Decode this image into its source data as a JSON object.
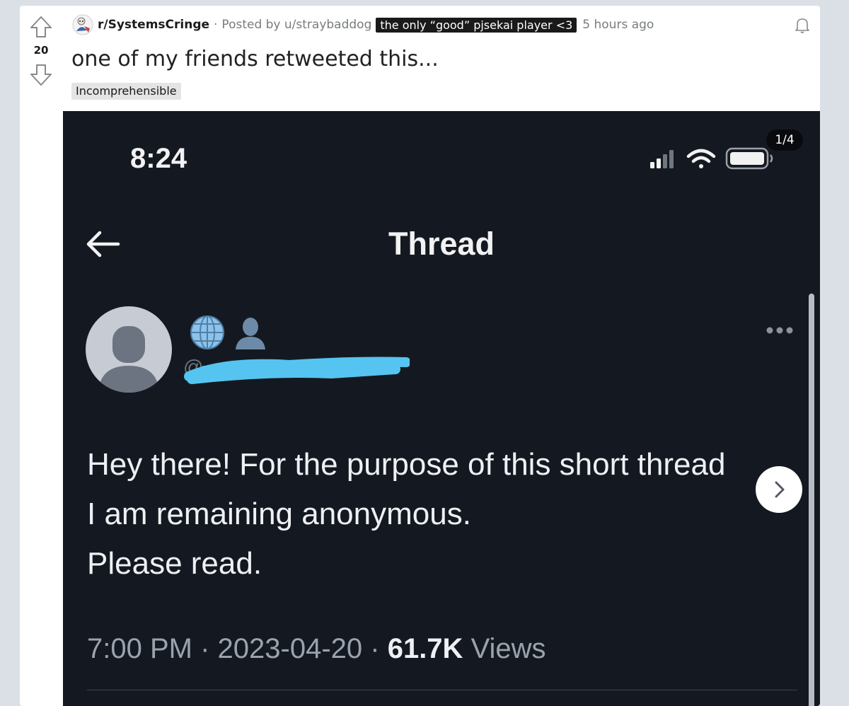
{
  "post": {
    "score": "20",
    "subreddit": "r/SystemsCringe",
    "posted_by": "Posted by u/straybaddog",
    "user_flair": "the only “good” pjsekai player <3",
    "age": "5 hours ago",
    "title": "one of my friends retweeted this...",
    "flair": "Incomprehensible"
  },
  "media": {
    "counter": "1/4",
    "phone": {
      "time": "8:24",
      "header_title": "Thread",
      "tweet_lines": "Hey there! For the purpose of this short thread\nI am remaining anonymous.\nPlease read.",
      "tweet_time": "7:00 PM",
      "tweet_date": "2023-04-20",
      "views_count": "61.7K",
      "views_label": "Views"
    }
  },
  "icons": {
    "upvote": "upvote-arrow-icon",
    "downvote": "downvote-arrow-icon",
    "subreddit_avatar": "subreddit-avatar-icon",
    "bell": "notification-bell-icon",
    "back": "back-arrow-icon",
    "signal": "signal-bars-icon",
    "wifi": "wifi-icon",
    "battery": "battery-icon",
    "globe": "globe-emoji-icon",
    "silhouette": "bust-silhouette-emoji-icon",
    "more": "more-options-icon",
    "next": "chevron-right-icon"
  },
  "colors": {
    "page_bg": "#dae0e6",
    "media_bg": "#141921",
    "redaction": "#55c4f0",
    "flair_bg": "#e4e4e4"
  }
}
